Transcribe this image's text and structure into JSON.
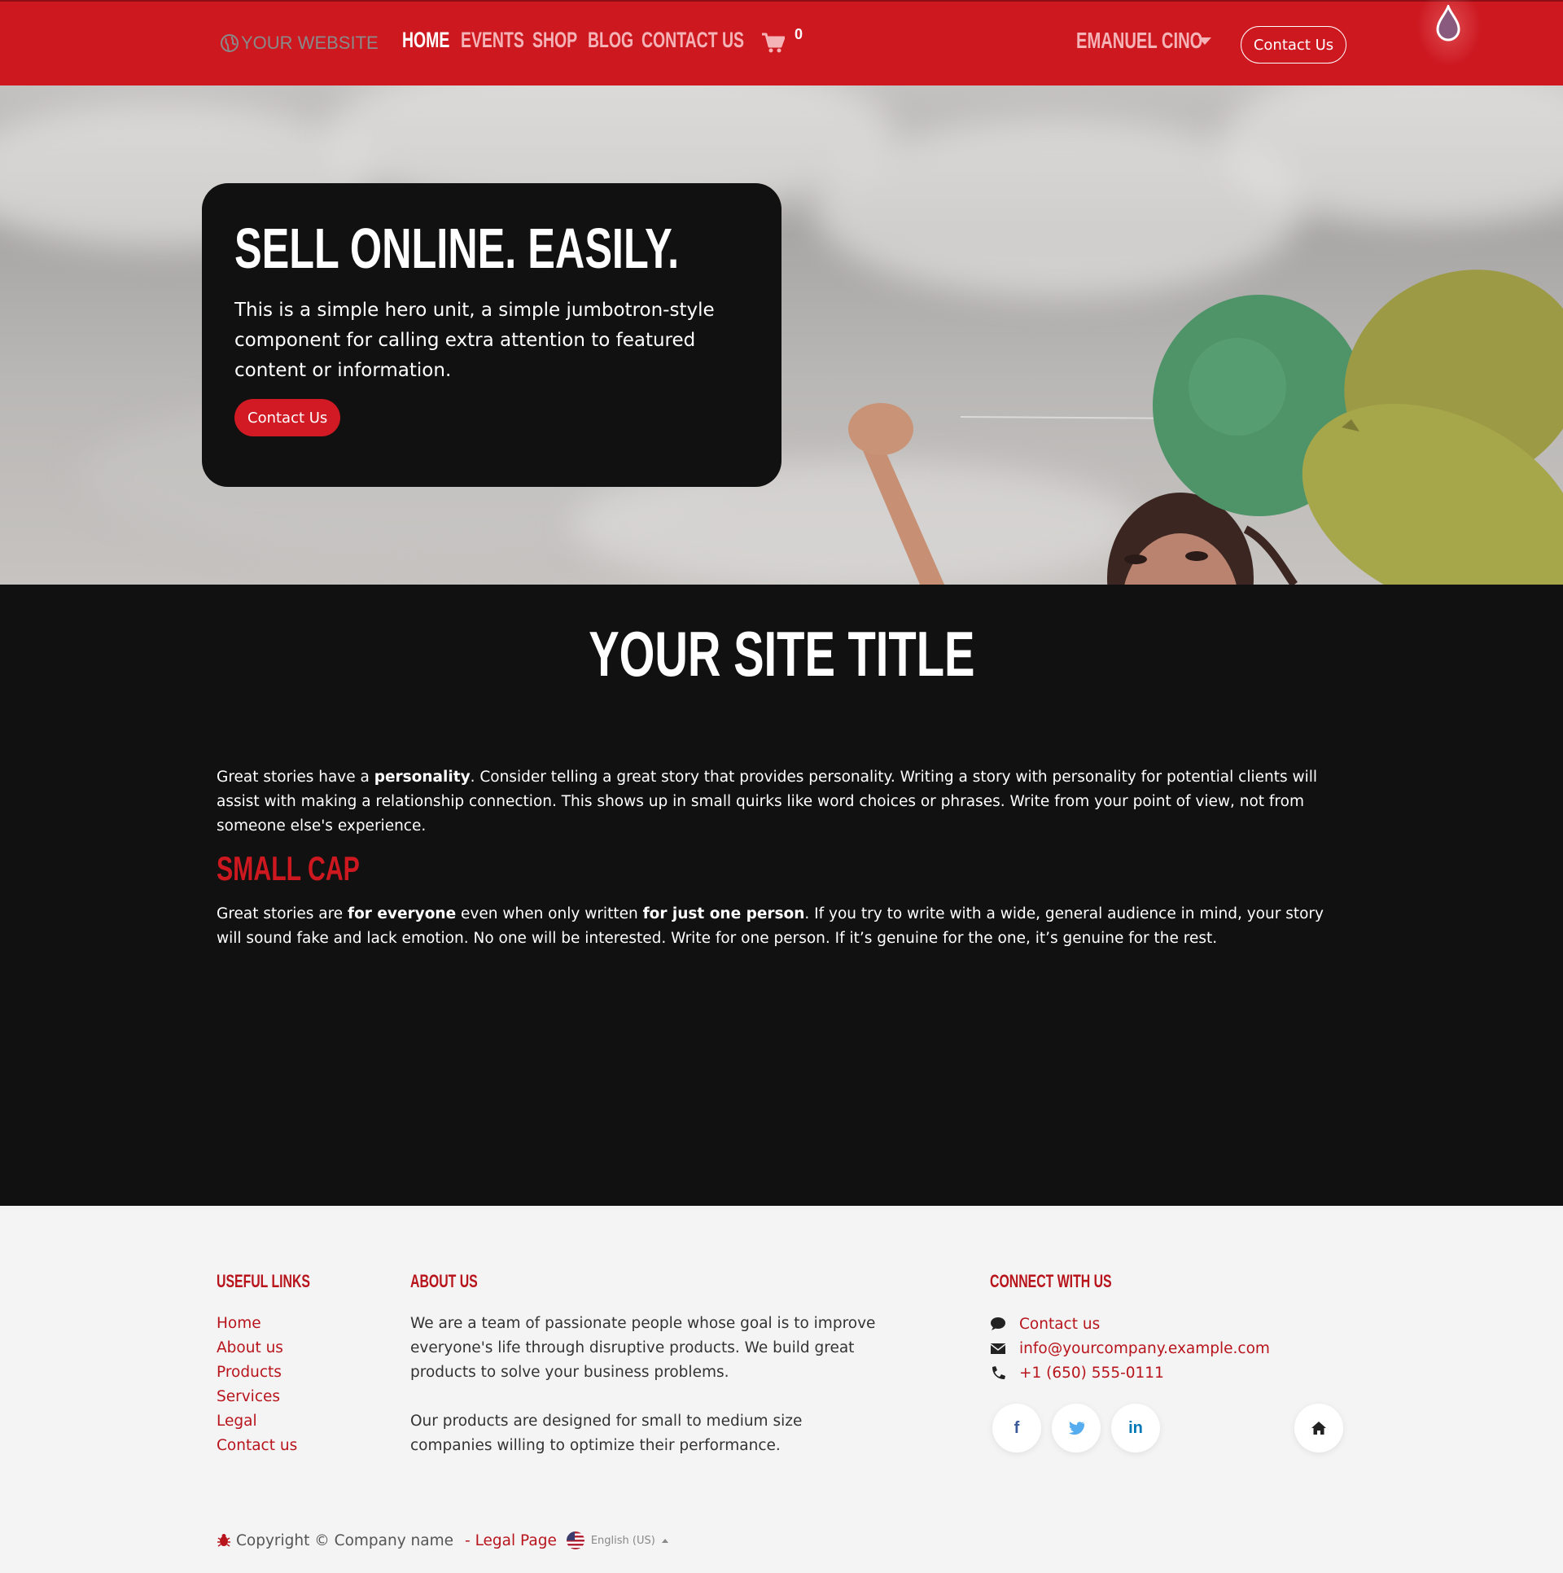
{
  "header": {
    "logo_text": "YOUR WEBSITE",
    "nav": [
      {
        "label": "Home",
        "active": true
      },
      {
        "label": "Events",
        "active": false
      },
      {
        "label": "Shop",
        "active": false
      },
      {
        "label": "Blog",
        "active": false
      },
      {
        "label": "Contact us",
        "active": false
      }
    ],
    "cart_count": "0",
    "user_name": "Emanuel Cino",
    "contact_button": "Contact Us",
    "brand_color": "#cd1820"
  },
  "hero": {
    "title": "Sell Online. Easily.",
    "text": "This is a simple hero unit, a simple jumbotron-style component for calling extra attention to featured content or information.",
    "button": "Contact Us"
  },
  "main": {
    "site_title": "Your Site Title",
    "para1": {
      "before": "Great stories have a ",
      "bold": "personality",
      "after": ". Consider telling a great story that provides personality. Writing a story with personality for potential clients will assist with making a relationship connection. This shows up in small quirks like word choices or phrases. Write from your point of view, not from someone else's experience."
    },
    "small_cap": "Small Cap",
    "para2": {
      "t1": "Great stories are ",
      "b1": "for everyone",
      "t2": " even when only written ",
      "b2": "for just one person",
      "t3": ". If you try to write with a wide, general audience in mind, your story will sound fake and lack emotion. No one will be interested. Write for one person. If it’s genuine for the one, it’s genuine for the rest."
    }
  },
  "footer": {
    "useful_links_title": "Useful Links",
    "useful_links": [
      "Home",
      "About us",
      "Products",
      "Services",
      "Legal",
      "Contact us"
    ],
    "about_title": "About us",
    "about_p1": "We are a team of passionate people whose goal is to improve everyone's life through disruptive products. We build great products to solve your business problems.",
    "about_p2": "Our products are designed for small to medium size companies willing to optimize their performance.",
    "connect_title": "Connect with us",
    "contact_link": "Contact us",
    "email": "info@yourcompany.example.com",
    "phone": "+1 (650) 555-0111",
    "social": [
      {
        "icon": "facebook-icon",
        "glyph": "f",
        "color": "#3b5998"
      },
      {
        "icon": "twitter-icon",
        "glyph": "t",
        "color": "#55acee"
      },
      {
        "icon": "linkedin-icon",
        "glyph": "in",
        "color": "#0077b5"
      }
    ],
    "copyright": "Copyright © Company name",
    "legal": "- Legal Page",
    "language": "English (US)"
  }
}
